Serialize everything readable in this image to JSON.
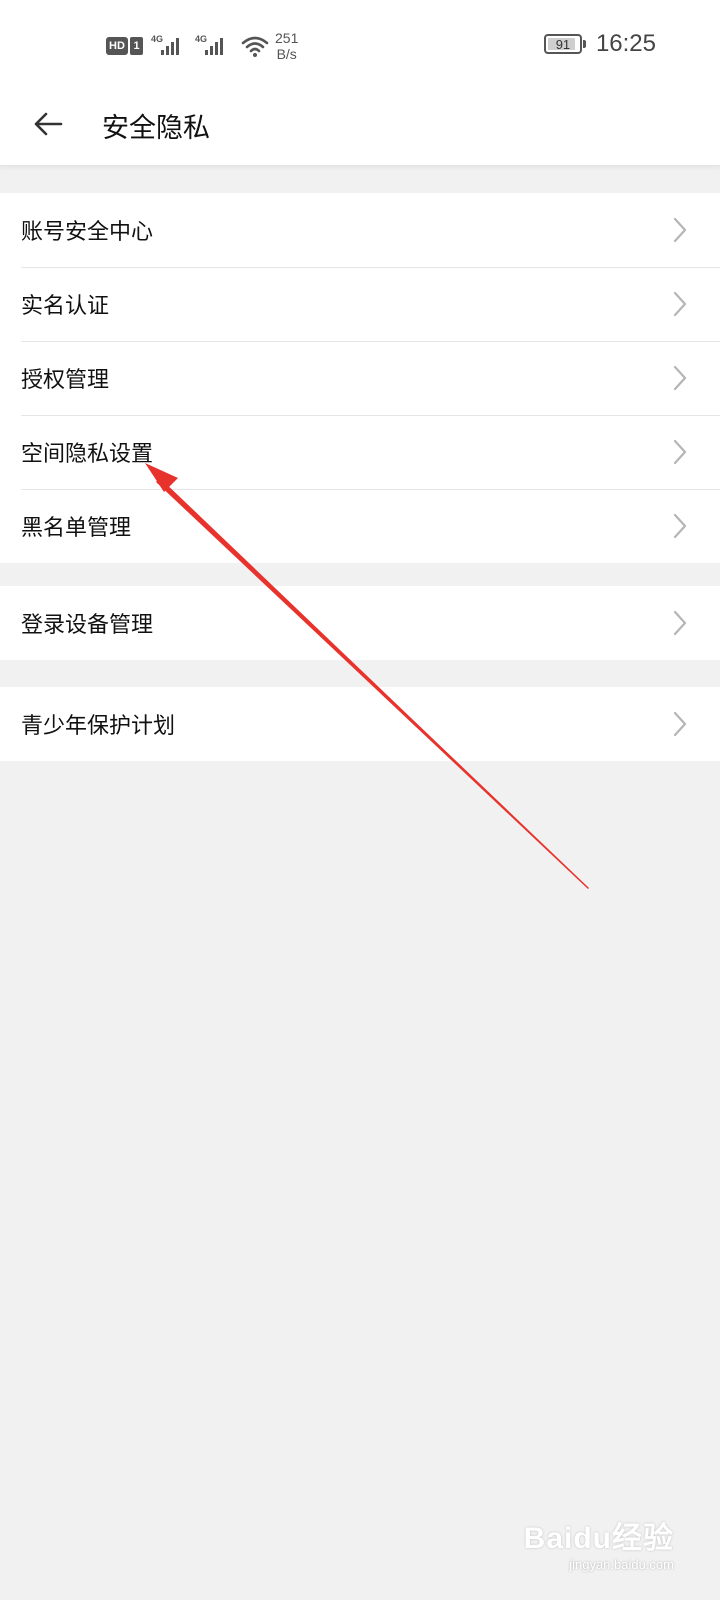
{
  "status_bar": {
    "hd": "HD",
    "sim": "1",
    "network_1": "4G",
    "network_2": "4G",
    "speed_value": "251",
    "speed_unit": "B/s",
    "battery_level": "91",
    "time": "16:25",
    "icons": [
      "hd-icon",
      "signal-icon",
      "signal-icon",
      "wifi-icon",
      "battery-icon"
    ]
  },
  "header": {
    "back_icon": "arrow-left-icon",
    "title": "安全隐私"
  },
  "groups": [
    {
      "items": [
        {
          "label": "账号安全中心"
        },
        {
          "label": "实名认证"
        },
        {
          "label": "授权管理"
        },
        {
          "label": "空间隐私设置"
        },
        {
          "label": "黑名单管理"
        }
      ]
    },
    {
      "items": [
        {
          "label": "登录设备管理"
        }
      ]
    },
    {
      "items": [
        {
          "label": "青少年保护计划"
        }
      ]
    }
  ],
  "chevron_icon": "chevron-right-icon",
  "annotation": {
    "color": "#e8322c",
    "points_to": "空间隐私设置"
  },
  "watermark": {
    "brand": "Baidu经验",
    "domain": "jingyan.baidu.com"
  },
  "colors": {
    "background": "#f1f1f2",
    "surface": "#ffffff",
    "divider": "#e6e6e6",
    "chevron": "#b5b5b5",
    "text_primary": "#111111"
  }
}
